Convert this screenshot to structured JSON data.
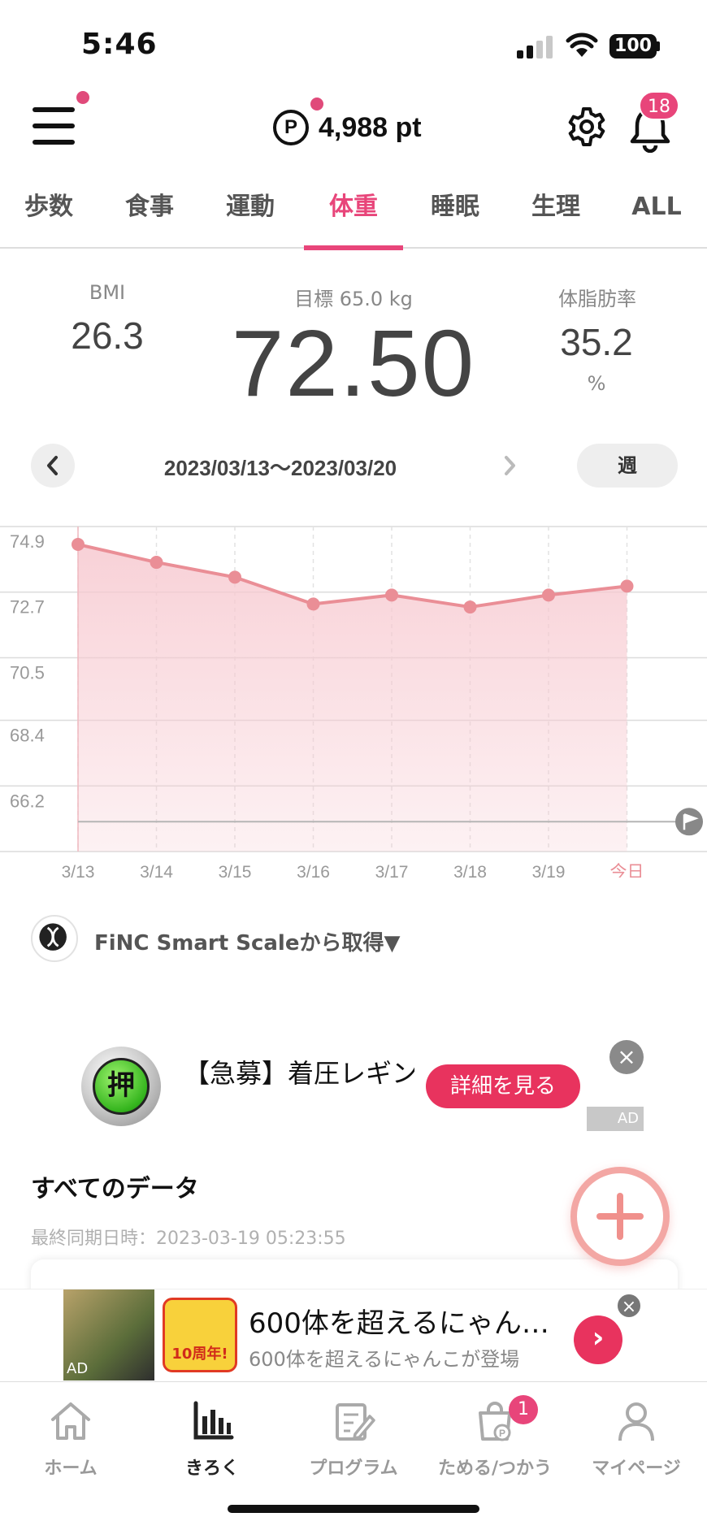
{
  "status_bar": {
    "time": "5:46",
    "battery": "100"
  },
  "header": {
    "points_symbol": "P",
    "points": "4,988 pt",
    "notification_count": "18"
  },
  "tabs": [
    {
      "label": "歩数",
      "active": false
    },
    {
      "label": "食事",
      "active": false
    },
    {
      "label": "運動",
      "active": false
    },
    {
      "label": "体重",
      "active": true
    },
    {
      "label": "睡眠",
      "active": false
    },
    {
      "label": "生理",
      "active": false
    },
    {
      "label": "ALL",
      "active": false
    }
  ],
  "stats": {
    "bmi_label": "BMI",
    "bmi_value": "26.3",
    "goal_label": "目標 65.0 kg",
    "weight": "72.50",
    "bodyfat_label": "体脂肪率",
    "bodyfat_value": "35.2",
    "bodyfat_unit": "%"
  },
  "date_nav": {
    "range": "2023/03/13～2023/03/20",
    "period": "週"
  },
  "chart_data": {
    "type": "area",
    "categories": [
      "3/13",
      "3/14",
      "3/15",
      "3/16",
      "3/17",
      "3/18",
      "3/19",
      "今日"
    ],
    "values": [
      74.3,
      73.7,
      73.2,
      72.3,
      72.6,
      72.2,
      72.6,
      72.9
    ],
    "y_ticks": [
      "74.9",
      "72.7",
      "70.5",
      "68.4",
      "66.2"
    ],
    "ylim": [
      64.0,
      74.9
    ],
    "goal": 65.0,
    "grid": true,
    "colors": {
      "line": "#ea8e96",
      "fill": "#f7c9d0",
      "today": "#ea8e96"
    }
  },
  "source": {
    "text": "FiNC Smart Scaleから取得▼"
  },
  "ad_banner": {
    "icon_text": "押",
    "title": "【急募】着圧レギンス",
    "button": "詳細を見る",
    "close": "×",
    "label": "AD"
  },
  "all_data": {
    "title": "すべてのデータ",
    "last_sync": "最終同期日時：2023-03-19 05:23:55"
  },
  "bottom_ad": {
    "thumb_label": "AD",
    "logo_text": "10周年!",
    "title": "600体を超えるにゃん…",
    "subtitle": "600体を超えるにゃんこが登場",
    "arrow": "›",
    "close": "×"
  },
  "bottom_nav": [
    {
      "label": "ホーム",
      "active": false
    },
    {
      "label": "きろく",
      "active": true
    },
    {
      "label": "プログラム",
      "active": false
    },
    {
      "label": "ためる/つかう",
      "active": false,
      "badge": "1"
    },
    {
      "label": "マイページ",
      "active": false
    }
  ]
}
